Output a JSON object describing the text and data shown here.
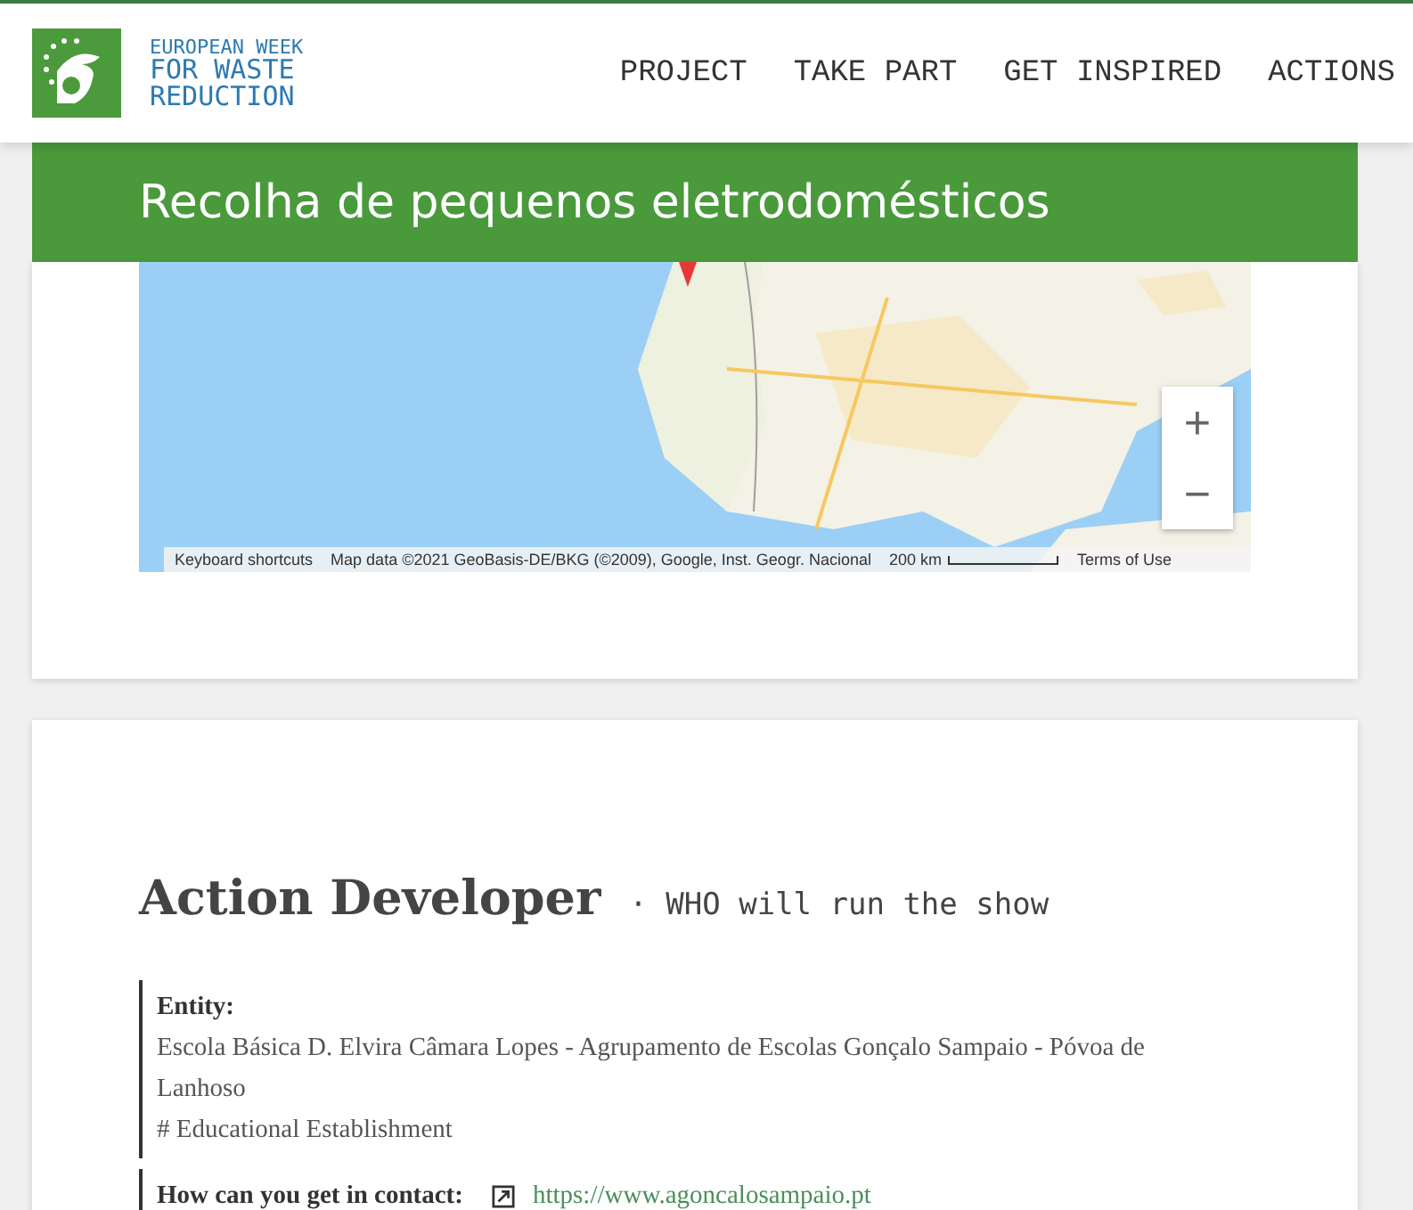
{
  "header": {
    "logo_lines": [
      "EUROPEAN WEEK",
      "FOR WASTE",
      "REDUCTION"
    ],
    "nav": [
      {
        "label": "PROJECT"
      },
      {
        "label": "TAKE PART"
      },
      {
        "label": "GET INSPIRED"
      },
      {
        "label": "ACTIONS"
      }
    ]
  },
  "banner": {
    "title": "Recolha de pequenos eletrodomésticos"
  },
  "map": {
    "kind": "picture",
    "zoom_in": "+",
    "zoom_out": "−",
    "footer": [
      "Keyboard shortcuts",
      "Map data ©2021 GeoBasis-DE/BKG (©2009), Google, Inst. Geogr. Nacional",
      "200 km",
      "Terms of Use"
    ]
  },
  "developer": {
    "title": "Action Developer",
    "subtitle": "· WHO will run the show",
    "entity_label": "Entity:",
    "entity_name": "Escola Básica D. Elvira Câmara Lopes - Agrupamento de Escolas Gonçalo Sampaio - Póvoa de Lanhoso",
    "entity_type": "# Educational Establishment",
    "contact_label": "How can you get in contact:",
    "contact_link": "https://www.agoncalosampaio.pt"
  }
}
